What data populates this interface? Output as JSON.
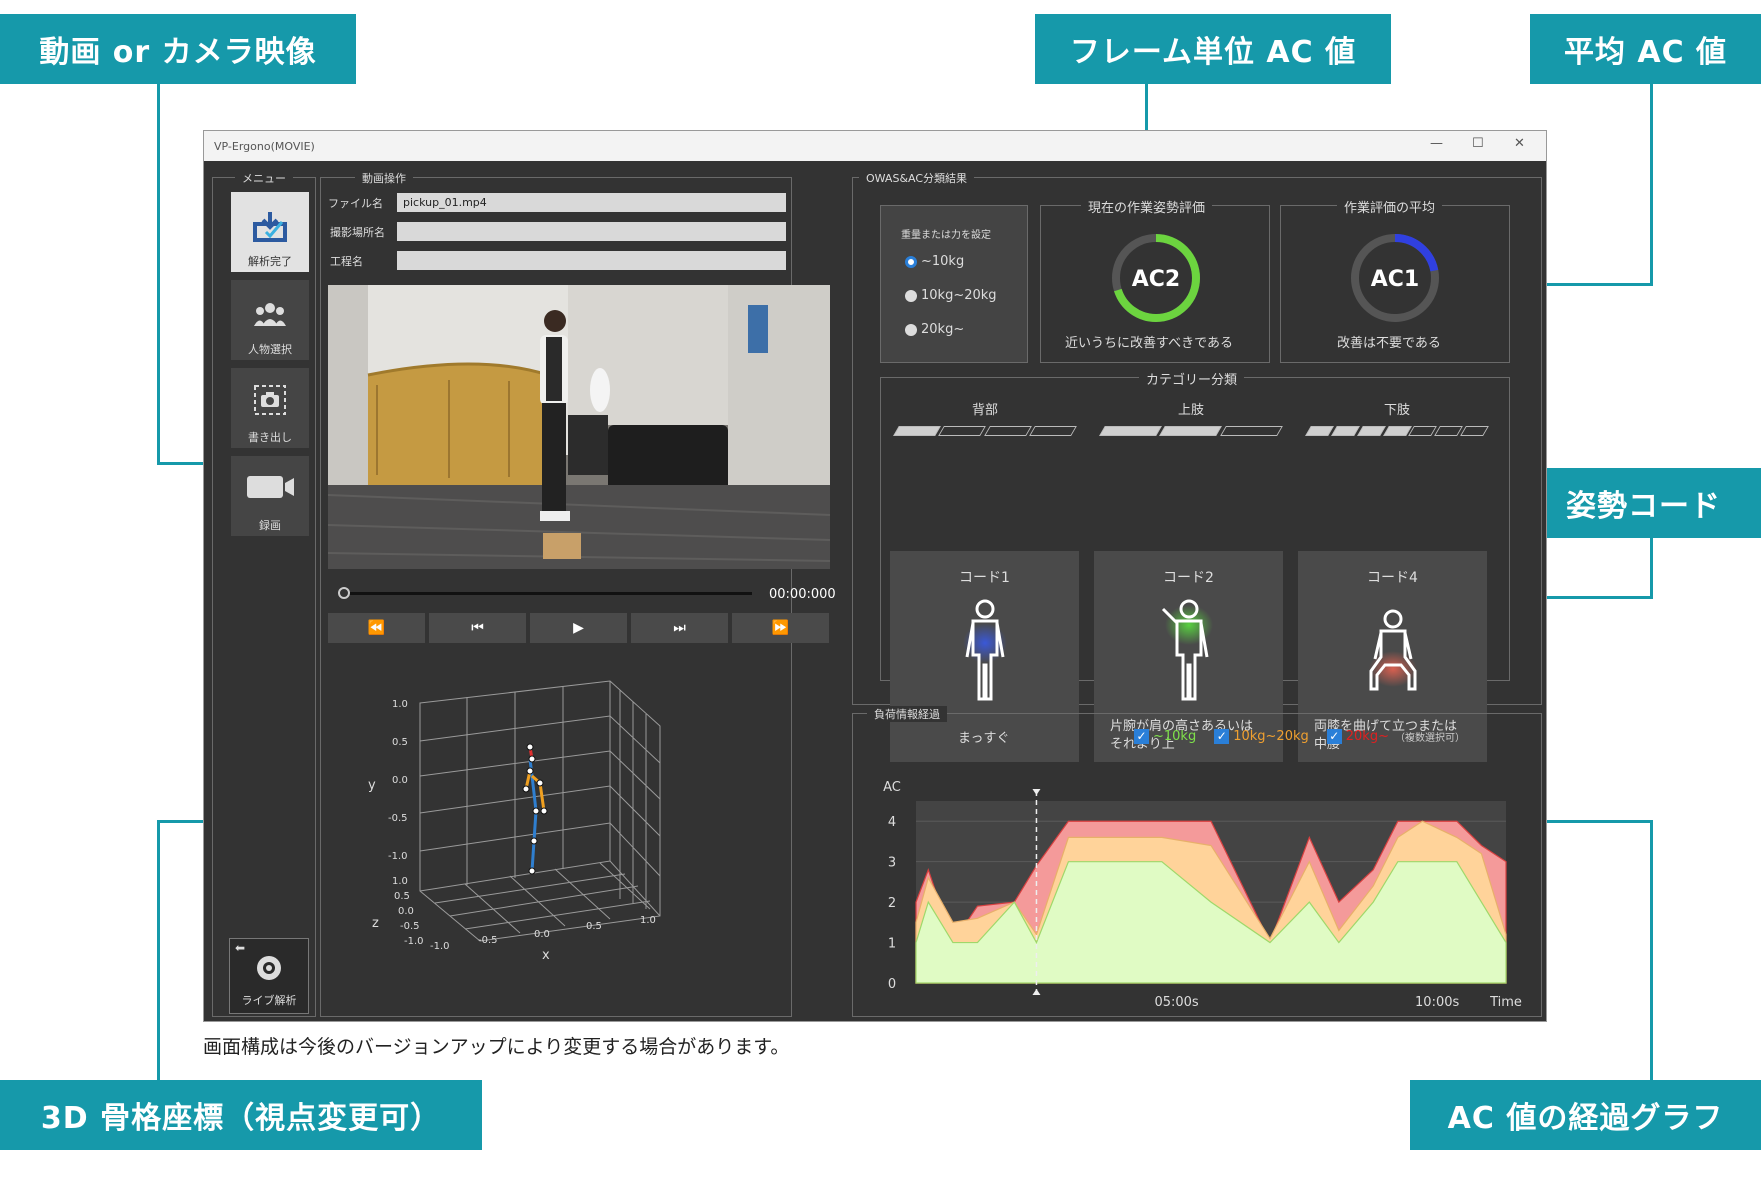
{
  "callouts": {
    "video": "動画 or カメラ映像",
    "frame_ac": "フレーム単位 AC 値",
    "avg_ac": "平均 AC 値",
    "posture": "姿勢コード",
    "skeleton3d": "3D 骨格座標（視点変更可）",
    "ac_graph": "AC 値の経過グラフ"
  },
  "window": {
    "title": "VP-Ergono(MOVIE)",
    "minimize": "—",
    "maximize": "☐",
    "close": "✕"
  },
  "menu": {
    "title": "メニュー",
    "items": [
      {
        "label": "解析完了",
        "icon": "download-check-icon",
        "active": true
      },
      {
        "label": "人物選択",
        "icon": "people-icon",
        "active": false
      },
      {
        "label": "書き出し",
        "icon": "camera-export-icon",
        "active": false
      },
      {
        "label": "録画",
        "icon": "video-camera-icon",
        "active": false
      }
    ],
    "live": "ライブ解析"
  },
  "video_ops": {
    "title": "動画操作",
    "file_label": "ファイル名",
    "file_value": "pickup_01.mp4",
    "location_label": "撮影場所名",
    "location_value": "",
    "process_label": "工程名",
    "process_value": "",
    "timecode": "00:00:000",
    "progress": 0,
    "controls": [
      "⏪",
      "⏮",
      "▶",
      "⏭",
      "⏩"
    ]
  },
  "skeleton_plot": {
    "ylabel": "y",
    "zlabel": "z",
    "xlabel": "x",
    "y_ticks": [
      "1.0",
      "0.5",
      "0.0",
      "-0.5",
      "-1.0"
    ],
    "z_ticks": [
      "1.0",
      "0.5",
      "0.0",
      "-0.5",
      "-1.0"
    ],
    "x_ticks": [
      "-1.0",
      "-0.5",
      "0.0",
      "0.5",
      "1.0"
    ]
  },
  "results": {
    "title": "OWAS&AC分類結果",
    "weight_title": "重量または力を設定",
    "weight_options": [
      {
        "label": "~10kg",
        "selected": true
      },
      {
        "label": "10kg~20kg",
        "selected": false
      },
      {
        "label": "20kg~",
        "selected": false
      }
    ],
    "current": {
      "title": "現在の作業姿勢評価",
      "value": "AC2",
      "desc": "近いうちに改善すべきである",
      "level": 0.7,
      "color": "#6cd43f"
    },
    "average": {
      "title": "作業評価の平均",
      "value": "AC1",
      "desc": "改善は不要である",
      "level": 0.22,
      "color": "#3040e0"
    },
    "category_title": "カテゴリー分類",
    "categories": [
      {
        "name": "背部",
        "code": "コード1",
        "desc": "まっすぐ",
        "filled": 1,
        "segments": 4,
        "glow": "#3a58d8"
      },
      {
        "name": "上肢",
        "code": "コード2",
        "desc": "片腕が肩の高さあるいは\nそれより上",
        "filled": 2,
        "segments": 3,
        "glow": "#58d040"
      },
      {
        "name": "下肢",
        "code": "コード4",
        "desc": "両膝を曲げて立つまたは\n中腰",
        "filled": 4,
        "segments": 7,
        "glow": "#d86050"
      }
    ]
  },
  "load_graph": {
    "title": "負荷情報経過",
    "legend": [
      {
        "label": "~10kg",
        "color": "#7ee04a",
        "checked": true
      },
      {
        "label": "10kg~20kg",
        "color": "#f0a030",
        "checked": true
      },
      {
        "label": "20kg~",
        "color": "#e02020",
        "checked": true
      }
    ],
    "legend_note": "（複数選択可）",
    "ylabel": "AC",
    "y_ticks": [
      "0",
      "1",
      "2",
      "3",
      "4"
    ],
    "x_ticks": [
      "05:00s",
      "10:00s"
    ],
    "xlabel": "Time"
  },
  "chart_data": {
    "type": "area",
    "ylabel": "AC",
    "xlabel": "Time",
    "ylim": [
      0,
      4
    ],
    "x_ticks": [
      "05:00s",
      "10:00s"
    ],
    "x": [
      0,
      0.25,
      0.75,
      1.25,
      2.0,
      2.45,
      3.1,
      4.0,
      5.0,
      6.0,
      7.2,
      8.0,
      8.6,
      9.3,
      9.8,
      10.3,
      11.0,
      11.5,
      12.0
    ],
    "series": [
      {
        "name": "~10kg",
        "color": "#e0fbc4",
        "values": [
          1,
          2,
          1,
          1,
          2,
          1,
          3,
          3,
          3,
          2,
          1,
          2,
          1,
          2,
          3,
          3,
          3,
          2,
          1
        ]
      },
      {
        "name": "10kg~20kg",
        "color": "#ffd39a",
        "values": [
          1.5,
          2.6,
          1.5,
          1.6,
          2.0,
          1.2,
          3.6,
          3.6,
          3.6,
          3.4,
          1.1,
          3.0,
          1.3,
          2.4,
          3.6,
          4.0,
          3.6,
          3.2,
          1.2
        ]
      },
      {
        "name": "20kg~",
        "color": "#f49a9a",
        "values": [
          2.0,
          2.8,
          1.0,
          1.9,
          2.0,
          2.9,
          4.0,
          4.0,
          4.0,
          4.0,
          1.0,
          3.6,
          2.0,
          2.8,
          4.0,
          4.0,
          4.0,
          3.4,
          3.0
        ]
      }
    ],
    "marker_x": 2.45
  },
  "footnote": "画面構成は今後のバージョンアップにより変更する場合があります。"
}
